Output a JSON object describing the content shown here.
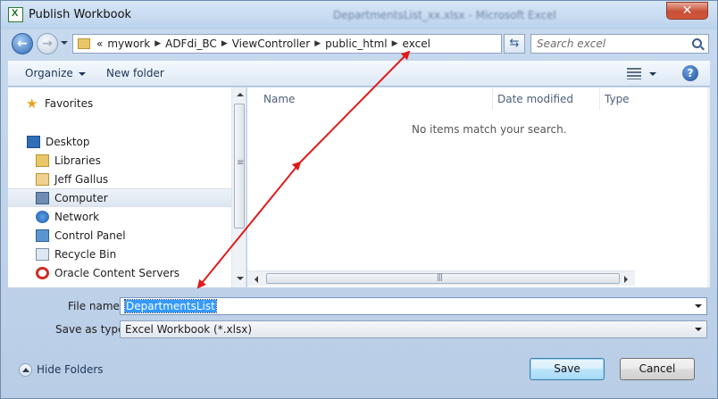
{
  "window": {
    "title": "Publish Workbook",
    "background_title": "DepartmentsList_xx.xlsx - Microsoft Excel",
    "close_glyph": "✕"
  },
  "address": {
    "overflow": "«",
    "crumbs": [
      "mywork",
      "ADFdi_BC",
      "ViewController",
      "public_html",
      "excel"
    ],
    "search_placeholder": "Search excel"
  },
  "toolbar": {
    "organize_label": "Organize",
    "new_folder_label": "New folder"
  },
  "nav": {
    "items": [
      {
        "label": "Favorites",
        "icon": "star-icon"
      },
      {
        "label": "Desktop",
        "icon": "desktop-icon"
      },
      {
        "label": "Libraries",
        "icon": "libraries-icon"
      },
      {
        "label": "Jeff Gallus",
        "icon": "user-folder-icon"
      },
      {
        "label": "Computer",
        "icon": "computer-icon",
        "selected": true
      },
      {
        "label": "Network",
        "icon": "network-icon"
      },
      {
        "label": "Control Panel",
        "icon": "control-panel-icon"
      },
      {
        "label": "Recycle Bin",
        "icon": "recycle-bin-icon"
      },
      {
        "label": "Oracle Content Servers",
        "icon": "oracle-icon"
      }
    ]
  },
  "file_list": {
    "columns": [
      "Name",
      "Date modified",
      "Type"
    ],
    "empty_message": "No items match your search."
  },
  "form": {
    "file_name_label": "File name:",
    "file_name_value": "DepartmentsList",
    "save_as_type_label": "Save as type:",
    "save_as_type_value": "Excel Workbook (*.xlsx)"
  },
  "footer": {
    "hide_folders_label": "Hide Folders",
    "save_label": "Save",
    "cancel_label": "Cancel"
  },
  "colors": {
    "annotation_arrow": "#e01b1b",
    "selection_highlight": "#3399ff"
  }
}
